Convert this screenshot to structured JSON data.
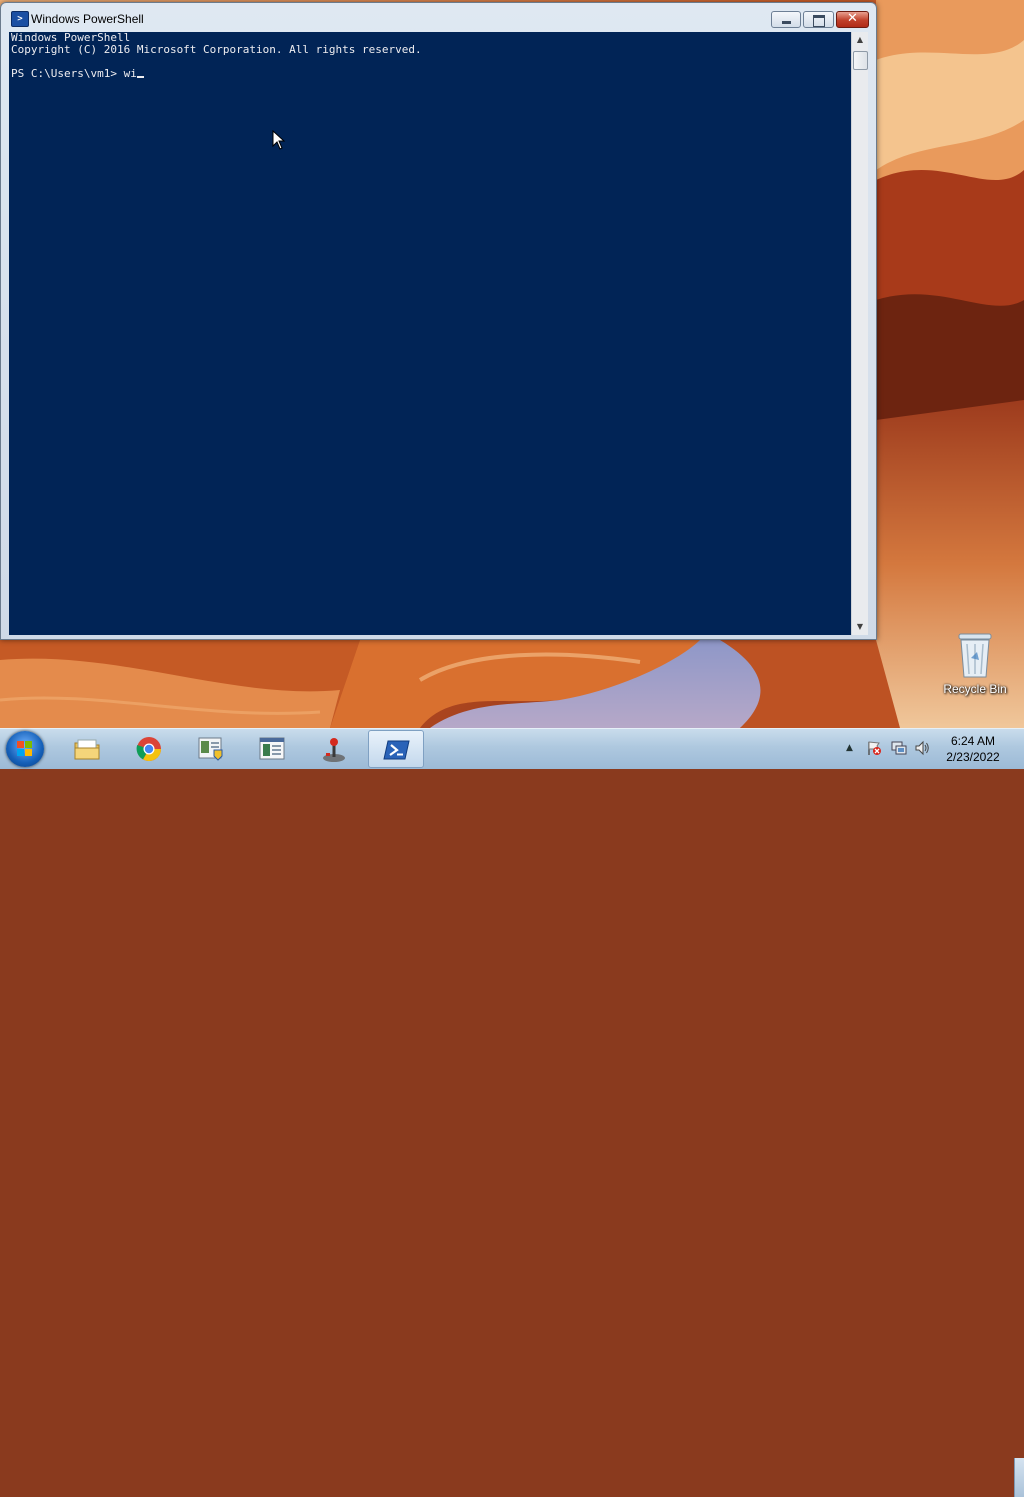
{
  "window": {
    "title": "Windows PowerShell",
    "console_lines": [
      "Windows PowerShell",
      "Copyright (C) 2016 Microsoft Corporation. All rights reserved.",
      "",
      "PS C:\\Users\\vm1> wi"
    ],
    "background_color": "#012456",
    "text_color": "#eeedf0"
  },
  "desktop": {
    "icons": [
      {
        "label": "Recycle Bin",
        "icon": "recycle-bin-icon"
      }
    ]
  },
  "taskbar": {
    "start_icon": "windows-start-icon",
    "items": [
      {
        "icon": "file-explorer-icon",
        "active": false
      },
      {
        "icon": "chrome-icon",
        "active": false
      },
      {
        "icon": "server-manager-icon",
        "active": false
      },
      {
        "icon": "event-viewer-icon",
        "active": false
      },
      {
        "icon": "joystick-icon",
        "active": false
      },
      {
        "icon": "powershell-icon",
        "active": true
      }
    ],
    "tray_icons": [
      "show-hidden-icons-arrow",
      "action-center-flag-icon",
      "network-icon",
      "volume-icon"
    ],
    "clock": {
      "time": "6:24 AM",
      "date": "2/23/2022"
    }
  }
}
